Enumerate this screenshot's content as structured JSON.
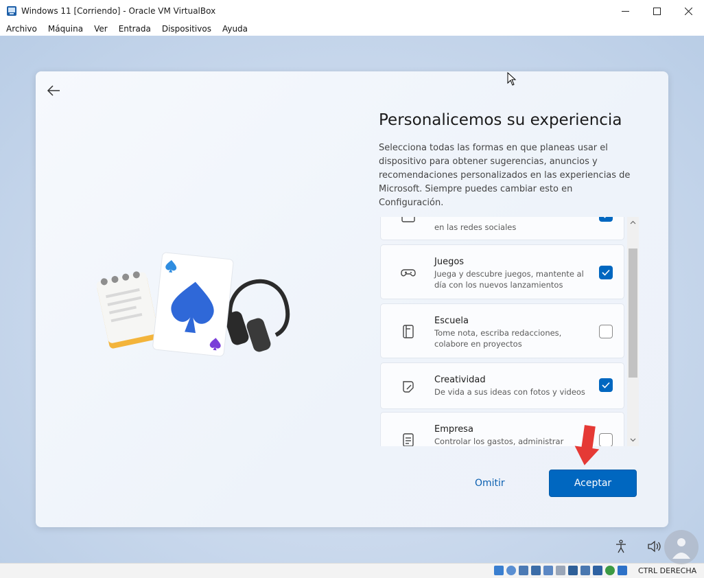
{
  "window": {
    "title": "Windows 11 [Corriendo] - Oracle VM VirtualBox"
  },
  "menubar": {
    "items": [
      "Archivo",
      "Máquina",
      "Ver",
      "Entrada",
      "Dispositivos",
      "Ayuda"
    ]
  },
  "oobe": {
    "heading": "Personalicemos su experiencia",
    "description": "Selecciona todas las formas en que planeas usar el dispositivo para obtener sugerencias, anuncios y recomendaciones personalizados en las experiencias de Microsoft. Siempre puedes cambiar esto en Configuración.",
    "items": [
      {
        "title": "",
        "subtitle": "en las redes sociales",
        "checked": true,
        "icon": "social-icon"
      },
      {
        "title": "Juegos",
        "subtitle": "Juega y descubre juegos, mantente al día con los nuevos lanzamientos",
        "checked": true,
        "icon": "gamepad-icon"
      },
      {
        "title": "Escuela",
        "subtitle": "Tome nota, escriba redacciones, colabore en proyectos",
        "checked": false,
        "icon": "notebook-icon"
      },
      {
        "title": "Creatividad",
        "subtitle": "De vida a sus ideas con fotos y videos",
        "checked": true,
        "icon": "pen-paper-icon"
      },
      {
        "title": "Empresa",
        "subtitle": "Controlar los gastos, administrar",
        "checked": false,
        "icon": "document-icon"
      }
    ],
    "skip_label": "Omitir",
    "accept_label": "Aceptar"
  },
  "statusbar": {
    "host_key": "CTRL DERECHA"
  },
  "colors": {
    "accent": "#0067c0",
    "arrow": "#e53935"
  }
}
